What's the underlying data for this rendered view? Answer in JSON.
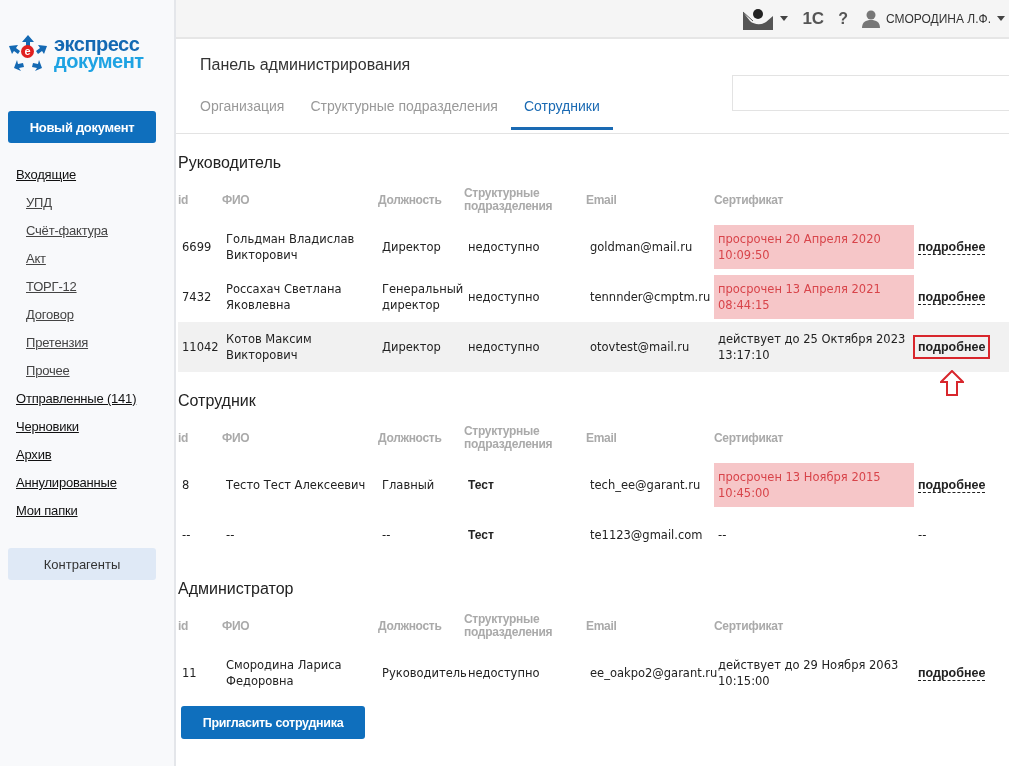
{
  "logo": {
    "mark": "e",
    "line1": "экспресс",
    "line2": "документ"
  },
  "sidebar": {
    "new_button": "Новый документ",
    "items": [
      {
        "label": "Входящие",
        "children": [
          {
            "label": "УПД"
          },
          {
            "label": "Счёт-фактура"
          },
          {
            "label": "Акт"
          },
          {
            "label": "ТОРГ-12"
          },
          {
            "label": "Договор"
          },
          {
            "label": "Претензия"
          },
          {
            "label": "Прочее"
          }
        ]
      },
      {
        "label": "Отправленные (141)"
      },
      {
        "label": "Черновики"
      },
      {
        "label": "Архив"
      },
      {
        "label": "Аннулированные"
      },
      {
        "label": "Мои папки"
      }
    ],
    "contractors_button": "Контрагенты"
  },
  "topbar": {
    "integration": "1С",
    "help": "?",
    "user": "СМОРОДИНА Л.Ф."
  },
  "panel": {
    "title": "Панель администрирования",
    "tabs": [
      {
        "label": "Организация",
        "selected": false
      },
      {
        "label": "Структурные подразделения",
        "selected": false
      },
      {
        "label": "Сотрудники",
        "selected": true
      }
    ]
  },
  "sections": [
    {
      "title": "Руководитель",
      "columns": [
        "id",
        "ФИО",
        "Должность",
        "Структурные подразделения",
        "Email",
        "Сертификат"
      ],
      "rows": [
        {
          "kind": "link",
          "id": "6699",
          "name": "Гольдман Владислав Викторович",
          "position": "Директор",
          "department": "недоступно",
          "department_bold": false,
          "email": "goldman@mail.ru",
          "certificate": "просрочен 20 Апреля 2020 10:09:50",
          "expired": true,
          "more": "подробнее",
          "selected": false,
          "highlighted": false
        },
        {
          "kind": "link",
          "id": "7432",
          "name": "Россахач Светлана Яковлевна",
          "position": "Генеральный директор",
          "department": "недоступно",
          "department_bold": false,
          "email": "tennnder@cmptm.ru",
          "certificate": "просрочен 13 Апреля 2021 08:44:15",
          "expired": true,
          "more": "подробнее",
          "selected": false,
          "highlighted": false
        },
        {
          "kind": "link",
          "id": "11042",
          "name": "Котов Максим Викторович",
          "position": "Директор",
          "department": "недоступно",
          "department_bold": false,
          "email": "otovtest@mail.ru",
          "certificate": "действует до 25 Октября 2023 13:17:10",
          "expired": false,
          "more": "подробнее",
          "selected": true,
          "highlighted": true
        }
      ]
    },
    {
      "title": "Сотрудник",
      "columns": [
        "id",
        "ФИО",
        "Должность",
        "Структурные подразделения",
        "Email",
        "Сертификат"
      ],
      "rows": [
        {
          "kind": "link",
          "id": "8",
          "name": "Тесто Тест Алексеевич",
          "position": "Главный",
          "department": "Тест",
          "department_bold": true,
          "email": "tech_ee@garant.ru",
          "certificate": "просрочен 13 Ноября 2015 10:45:00",
          "expired": true,
          "more": "подробнее",
          "selected": false,
          "highlighted": false
        },
        {
          "kind": "plain",
          "id": "--",
          "name": "--",
          "position": "--",
          "department": "Тест",
          "department_bold": true,
          "email": "te1123@gmail.com",
          "certificate": "--",
          "expired": false,
          "more": "--",
          "selected": false,
          "highlighted": false
        }
      ]
    },
    {
      "title": "Администратор",
      "columns": [
        "id",
        "ФИО",
        "Должность",
        "Структурные подразделения",
        "Email",
        "Сертификат"
      ],
      "rows": [
        {
          "kind": "link",
          "id": "11",
          "name": "Смородина Лариса Федоровна",
          "position": "Руководитель",
          "department": "недоступно",
          "department_bold": false,
          "email": "ee_oakpo2@garant.ru",
          "certificate": "действует до 29 Ноября 2063 10:15:00",
          "expired": false,
          "more": "подробнее",
          "selected": false,
          "highlighted": false
        }
      ]
    }
  ],
  "invite_button": "Пригласить сотрудника"
}
